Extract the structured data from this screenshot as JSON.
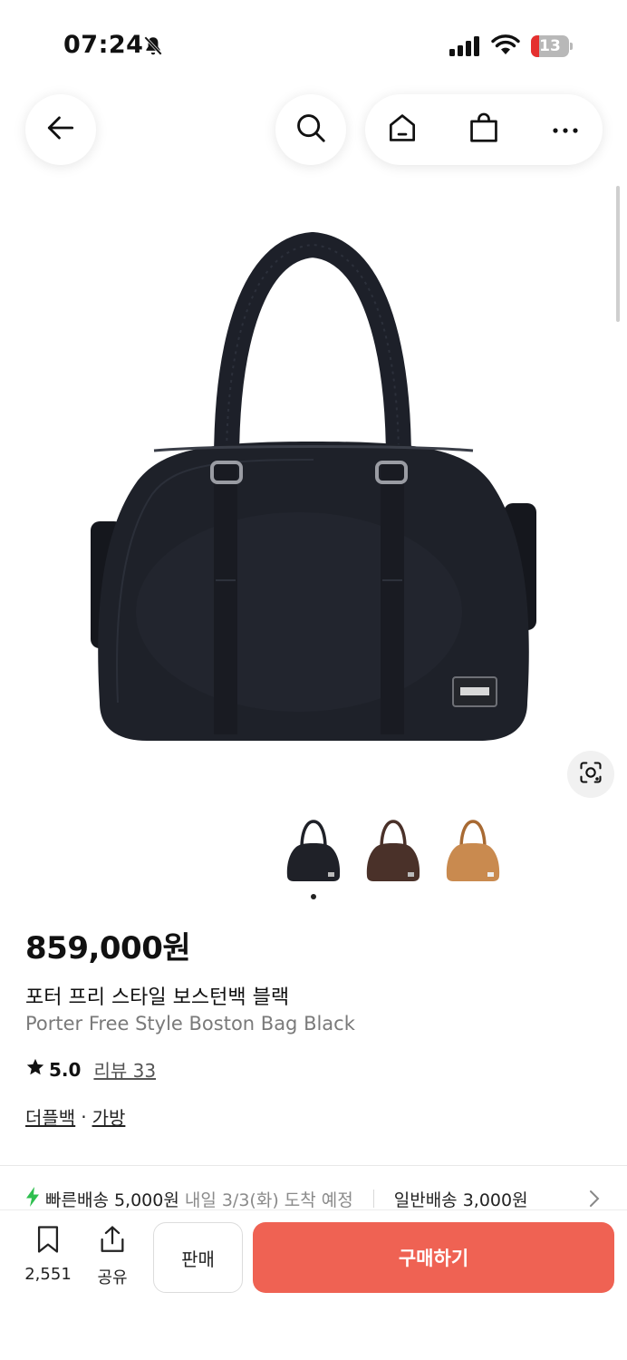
{
  "status_bar": {
    "time": "07:24",
    "battery": "13",
    "battery_level_percent": 13,
    "battery_low_color": "#e5302f"
  },
  "nav": {
    "back_icon": "arrow-left-icon",
    "search_icon": "search-icon",
    "home_icon": "home-icon",
    "cart_icon": "shopping-bag-icon",
    "more_icon": "more-horizontal-icon"
  },
  "product": {
    "image_icon": "boston-bag-black",
    "thumbnails": [
      {
        "name": "black",
        "color": "#1f2128"
      },
      {
        "name": "brown",
        "color": "#4a3129"
      },
      {
        "name": "tan",
        "color": "#c98a4f"
      }
    ],
    "selected_thumbnail_index": 0,
    "price": "859,000원",
    "title_ko": "포터 프리 스타일 보스턴백 블랙",
    "title_en": "Porter Free Style Boston Bag Black",
    "rating": "5.0",
    "review_label": "리뷰 33",
    "categories": [
      "더플백",
      "가방"
    ],
    "category_separator": "·"
  },
  "shipping": {
    "fast_label": "빠른배송 5,000원",
    "fast_eta": "내일 3/3(화) 도착 예정",
    "normal_label": "일반배송 3,000원",
    "accent_color": "#2fbf4f"
  },
  "bottom_bar": {
    "bookmark_count": "2,551",
    "share_label": "공유",
    "sell_label": "판매",
    "buy_label": "구매하기",
    "buy_color": "#ef6253"
  }
}
